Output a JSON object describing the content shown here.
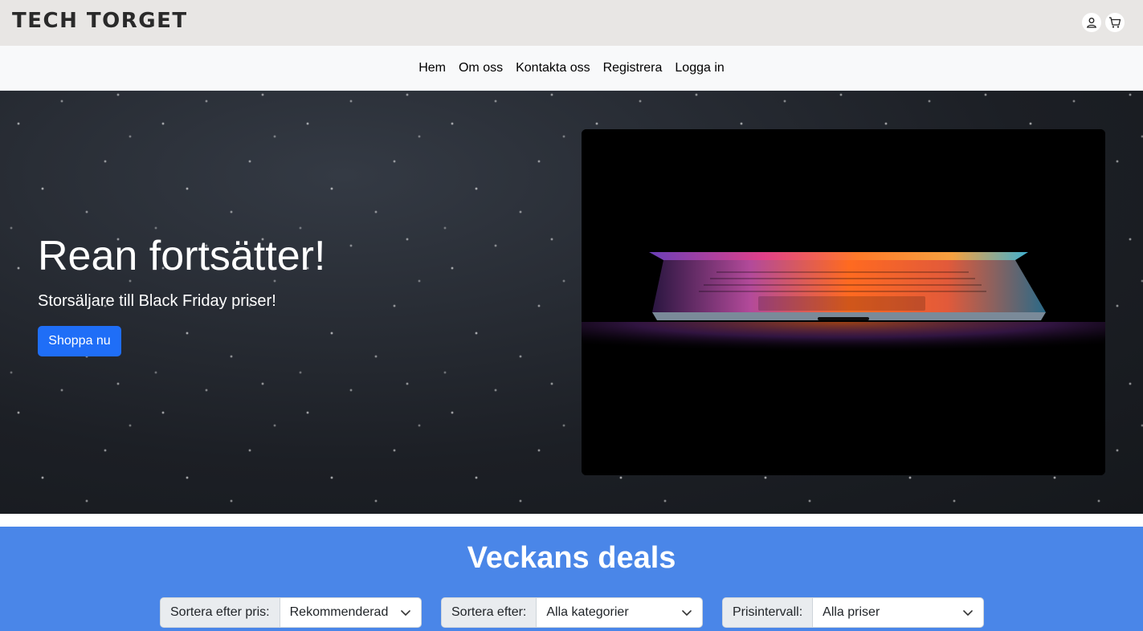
{
  "header": {
    "logo": "TECH TORGET",
    "icons": [
      "user-icon",
      "cart-icon"
    ]
  },
  "nav": {
    "links": [
      "Hem",
      "Om oss",
      "Kontakta oss",
      "Registrera",
      "Logga in"
    ]
  },
  "hero": {
    "title": "Rean fortsätter!",
    "subtitle": "Storsäljare till Black Friday priser!",
    "button_label": "Shoppa nu",
    "image": "laptop-photo"
  },
  "deals": {
    "title": "Veckans deals",
    "filters": [
      {
        "label": "Sortera efter pris:",
        "value": "Rekommenderad"
      },
      {
        "label": "Sortera efter:",
        "value": "Alla kategorier"
      },
      {
        "label": "Prisintervall:",
        "value": "Alla priser"
      }
    ]
  },
  "colors": {
    "topbar": "#e8e6e4",
    "navbar": "#f8f9fa",
    "primary_button": "#1f6ef7",
    "deals_background": "#4a86e8"
  }
}
